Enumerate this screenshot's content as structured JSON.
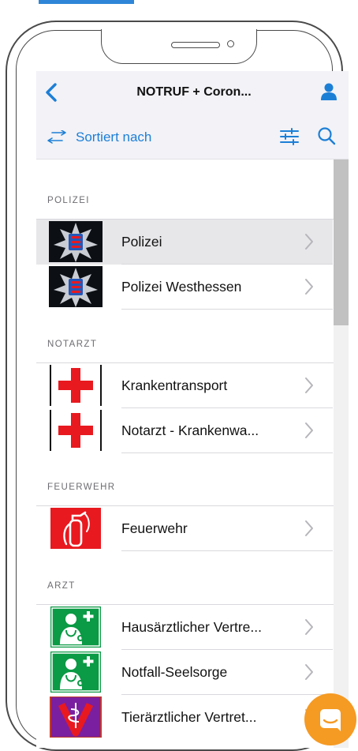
{
  "nav": {
    "title": "NOTRUF + Coron...",
    "back": "back",
    "profile": "profile"
  },
  "sortbar": {
    "label": "Sortiert nach"
  },
  "sections": [
    {
      "title": "POLIZEI",
      "items": [
        {
          "label": "Polizei",
          "icon": "police-badge-icon"
        },
        {
          "label": "Polizei Westhessen",
          "icon": "police-badge-icon"
        }
      ]
    },
    {
      "title": "NOTARZT",
      "items": [
        {
          "label": "Krankentransport",
          "icon": "red-cross-icon"
        },
        {
          "label": "Notarzt - Krankenwa...",
          "icon": "red-cross-icon"
        }
      ]
    },
    {
      "title": "FEUERWEHR",
      "items": [
        {
          "label": "Feuerwehr",
          "icon": "fire-extinguisher-icon"
        }
      ]
    },
    {
      "title": "ARZT",
      "items": [
        {
          "label": "Hausärztlicher Vertre...",
          "icon": "doctor-icon"
        },
        {
          "label": "Notfall-Seelsorge",
          "icon": "doctor-icon"
        },
        {
          "label": "Tierärztlicher Vertret...",
          "icon": "vet-icon"
        }
      ]
    }
  ],
  "colors": {
    "accent": "#1c7fd6",
    "fab": "#f59a23",
    "cross": "#e8191f"
  }
}
